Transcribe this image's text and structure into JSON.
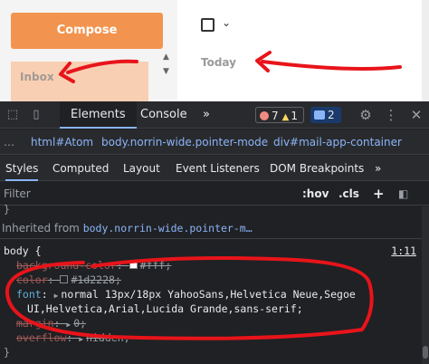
{
  "mail": {
    "compose_label": "Compose",
    "inbox_label": "Inbox",
    "today_label": "Today"
  },
  "devtools": {
    "tabs": [
      "Elements",
      "Console"
    ],
    "more_tabs": "»",
    "errors_count": "7",
    "warnings_count": "1",
    "messages_count": "2",
    "breadcrumbs": [
      "html#Atom",
      "body.norrin-wide.pointer-mode",
      "div#mail-app-container"
    ],
    "subtabs": [
      "Styles",
      "Computed",
      "Layout",
      "Event Listeners",
      "DOM Breakpoints"
    ],
    "more_subtabs": "»",
    "filter_placeholder": "Filter",
    "hov_label": ":hov",
    "cls_label": ".cls",
    "plus_label": "+",
    "inherited_prefix": "Inherited from",
    "inherited_selector": "body.norrin-wide.pointer-m…",
    "rule_selector": "body {",
    "rule_source": "1:11",
    "declarations": [
      {
        "prop": "background-color",
        "value": "#fff;",
        "struck": true,
        "swatch": "#ffffff"
      },
      {
        "prop": "color",
        "value": "#1d2228;",
        "struck": true,
        "swatch": "#1d2228"
      },
      {
        "prop": "font",
        "value_line1": "normal 13px/18px YahooSans,Helvetica Neue,Segoe",
        "value_line2": "UI,Helvetica,Arial,Lucida Grande,sans-serif;",
        "struck": false
      },
      {
        "prop": "margin",
        "value": "0;",
        "struck": true
      },
      {
        "prop": "overflow",
        "value": "hidden;",
        "struck": true
      }
    ]
  },
  "colors": {
    "compose_orange": "#f2944f",
    "annotation_red": "#e8141a",
    "devtools_bg": "#202124",
    "link_blue": "#8ab4f8"
  }
}
